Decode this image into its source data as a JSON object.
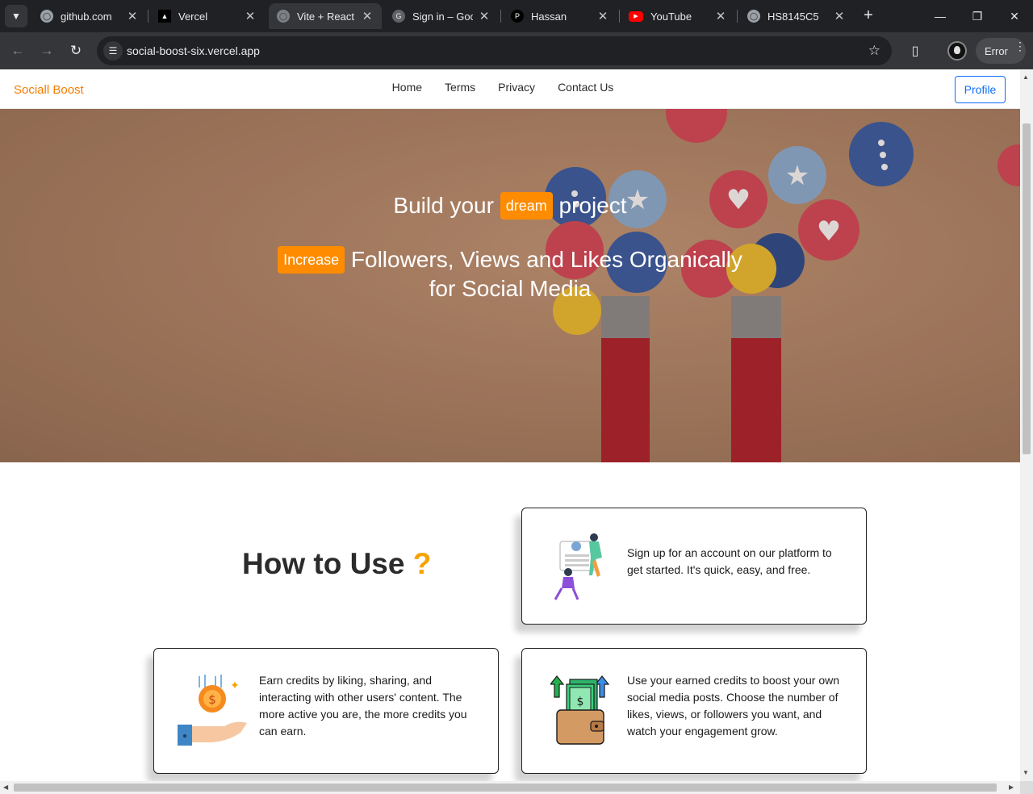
{
  "browser": {
    "tabs": [
      {
        "label": "github.com",
        "favicon": "globe-icon",
        "active": false
      },
      {
        "label": "Vercel",
        "favicon": "vercel-triangle-icon",
        "active": false
      },
      {
        "label": "Vite + React",
        "favicon": "globe-icon",
        "active": true
      },
      {
        "label": "Sign in – Goog",
        "favicon": "google-icon",
        "active": false
      },
      {
        "label": "Hassan",
        "favicon": "p-icon",
        "active": false
      },
      {
        "label": "YouTube",
        "favicon": "youtube-icon",
        "active": false
      },
      {
        "label": "HS8145C5",
        "favicon": "globe-icon",
        "active": false
      }
    ],
    "url": "social-boost-six.vercel.app",
    "error_label": "Error"
  },
  "site": {
    "brand": "Sociall Boost",
    "nav": [
      "Home",
      "Terms",
      "Privacy",
      "Contact Us"
    ],
    "profile_button": "Profile"
  },
  "hero": {
    "line1_before": "Build your",
    "line1_tag": "dream",
    "line1_after": "project",
    "line2_tag": "Increase",
    "line2_text": "Followers, Views and Likes Organically for Social Media"
  },
  "howto": {
    "title": "How to Use",
    "title_mark": "?",
    "steps": [
      {
        "text": "Sign up for an account on our platform to get started. It's quick, easy, and free.",
        "icon": "signup-illustration-icon"
      },
      {
        "text": "Earn credits by liking, sharing, and interacting with other users' content. The more active you are, the more credits you can earn.",
        "icon": "coin-hand-icon"
      },
      {
        "text": "Use your earned credits to boost your own social media posts. Choose the number of likes, views, or followers you want, and watch your engagement grow.",
        "icon": "money-wallet-icon"
      }
    ]
  },
  "colors": {
    "accent": "#ff8c00",
    "brand": "#f57c00",
    "profile_border": "#0d6efd",
    "title_mark": "#f5a300"
  }
}
